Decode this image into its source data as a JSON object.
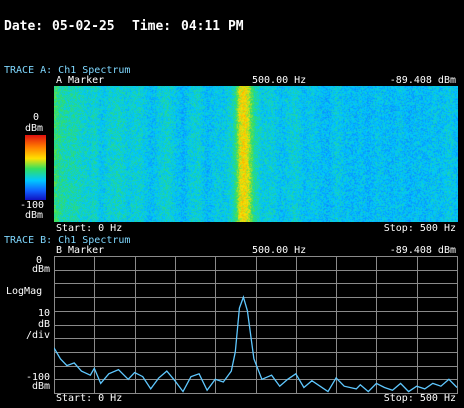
{
  "header": {
    "date_label": "Date:",
    "date": "05-02-25",
    "time_label": "Time:",
    "time": "04:11 PM"
  },
  "trace_a": {
    "title": "TRACE A: Ch1 Spectrum",
    "marker_label": "A Marker",
    "marker_freq": "500.00 Hz",
    "marker_value": "-89.408 dBm",
    "scale_top": "0",
    "scale_top_unit": "dBm",
    "scale_bottom": "-100",
    "scale_bottom_unit": "dBm",
    "start": "Start: 0 Hz",
    "stop": "Stop: 500 Hz",
    "colormap": [
      "#e01010",
      "#ff7a00",
      "#ffe000",
      "#33e060",
      "#00c8ff",
      "#1060ff",
      "#1010c0"
    ]
  },
  "trace_b": {
    "title": "TRACE B: Ch1 Spectrum",
    "marker_label": "B Marker",
    "marker_freq": "500.00 Hz",
    "marker_value": "-89.408 dBm",
    "ref_top": "0",
    "ref_top_unit": "dBm",
    "scale_type": "LogMag",
    "scale_per_div": "10",
    "scale_unit": "dB",
    "scale_div": "/div",
    "ref_bottom": "-100",
    "ref_bottom_unit": "dBm",
    "start": "Start: 0 Hz",
    "stop": "Stop: 500 Hz",
    "trace_color": "#5fc8ff"
  },
  "chart_data": {
    "type": "line",
    "x": [
      0,
      8,
      16,
      25,
      34,
      45,
      50,
      58,
      68,
      80,
      92,
      100,
      110,
      120,
      130,
      140,
      150,
      160,
      170,
      180,
      190,
      200,
      210,
      220,
      225,
      230,
      235,
      240,
      248,
      258,
      270,
      280,
      290,
      300,
      310,
      320,
      340,
      350,
      360,
      375,
      380,
      390,
      400,
      410,
      420,
      430,
      440,
      450,
      460,
      470,
      480,
      490,
      500
    ],
    "y": [
      -67,
      -75,
      -80,
      -78,
      -84,
      -87,
      -82,
      -93,
      -86,
      -83,
      -90,
      -85,
      -88,
      -97,
      -89,
      -84,
      -91,
      -99,
      -88,
      -86,
      -98,
      -90,
      -92,
      -84,
      -70,
      -38,
      -30,
      -40,
      -75,
      -90,
      -87,
      -95,
      -90,
      -86,
      -96,
      -91,
      -99,
      -89,
      -95,
      -97,
      -94,
      -99,
      -93,
      -96,
      -98,
      -93,
      -99,
      -95,
      -97,
      -93,
      -95,
      -90,
      -96
    ],
    "xlim": [
      0,
      500
    ],
    "ylim": [
      -100,
      0
    ],
    "grid": true,
    "xlabel": "",
    "ylabel": ""
  }
}
